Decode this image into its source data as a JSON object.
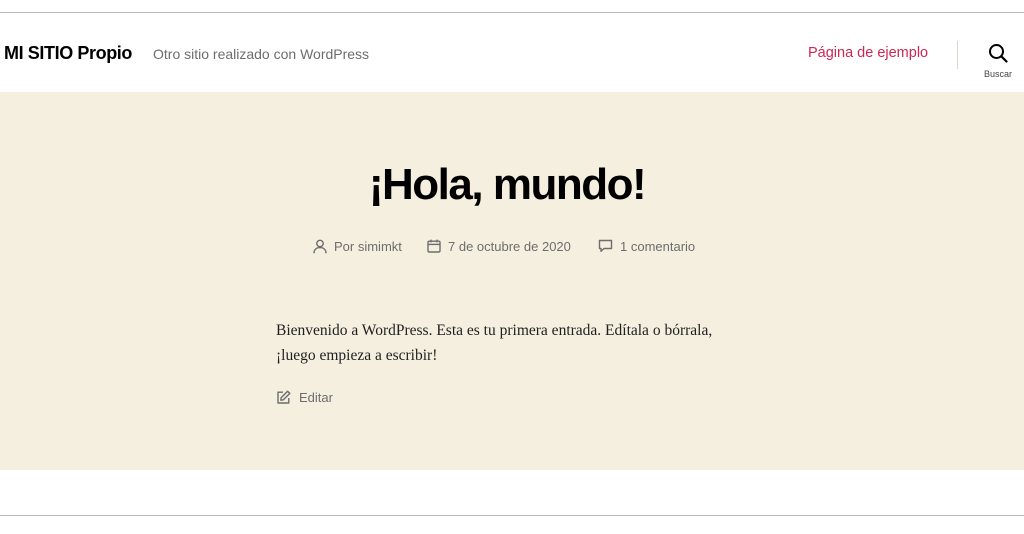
{
  "header": {
    "site_title": "MI SITIO Propio",
    "site_description": "Otro sitio realizado con WordPress",
    "nav_link": "Página de ejemplo",
    "search_label": "Buscar",
    "accent_color": "#cd2653"
  },
  "post": {
    "title": "¡Hola, mundo!",
    "author": "Por simimkt",
    "date": "7 de octubre de 2020",
    "comments": "1 comentario",
    "body": "Bienvenido a WordPress. Esta es tu primera entrada. Edítala o bórrala, ¡luego empieza a escribir!",
    "edit_label": "Editar",
    "background_color": "#f5efe0"
  },
  "icons": {
    "author": "person-icon",
    "date": "calendar-icon",
    "comments": "comment-icon",
    "edit": "edit-icon",
    "search": "search-icon"
  }
}
